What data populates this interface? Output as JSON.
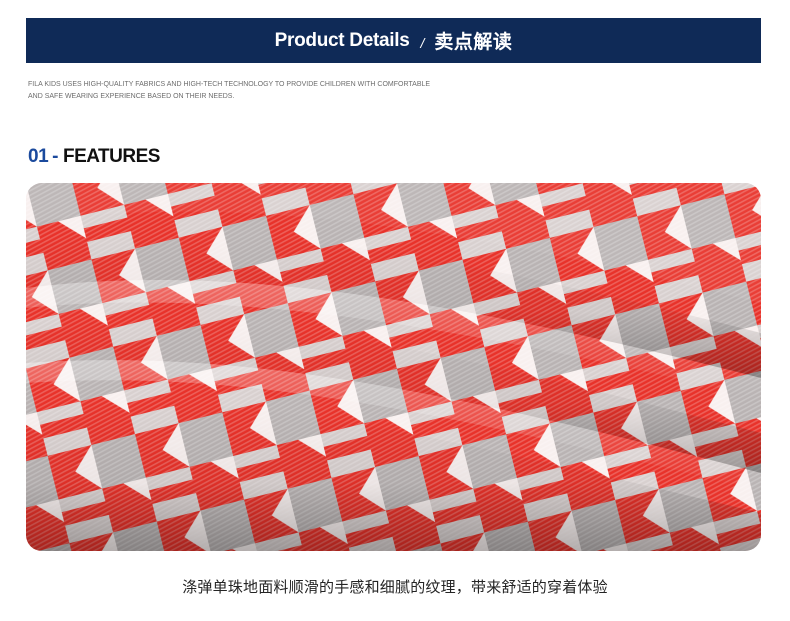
{
  "header": {
    "title_en": "Product Details",
    "separator": "/",
    "title_cn": "卖点解读"
  },
  "intro": {
    "line1": "FILA KIDS USES HIGH-QUALITY FABRICS AND HIGH-TECH TECHNOLOGY TO PROVIDE CHILDREN WITH COMFORTABLE",
    "line2": "AND SAFE WEARING EXPERIENCE BASED ON THEIR NEEDS."
  },
  "section": {
    "number": "01",
    "dash": "-",
    "title": "FEATURES"
  },
  "photo": {
    "subject": "red-white-grey-chevron-fabric-photo",
    "colors": {
      "red": "#e8322a",
      "white": "#f8f0ef",
      "grey": "#b9b3b3"
    }
  },
  "caption": "涤弹单珠地面料顺滑的手感和细腻的纹理，带来舒适的穿着体验",
  "colors": {
    "banner": "#0f2a57",
    "accent": "#1b4a9d",
    "text": "#242424"
  }
}
